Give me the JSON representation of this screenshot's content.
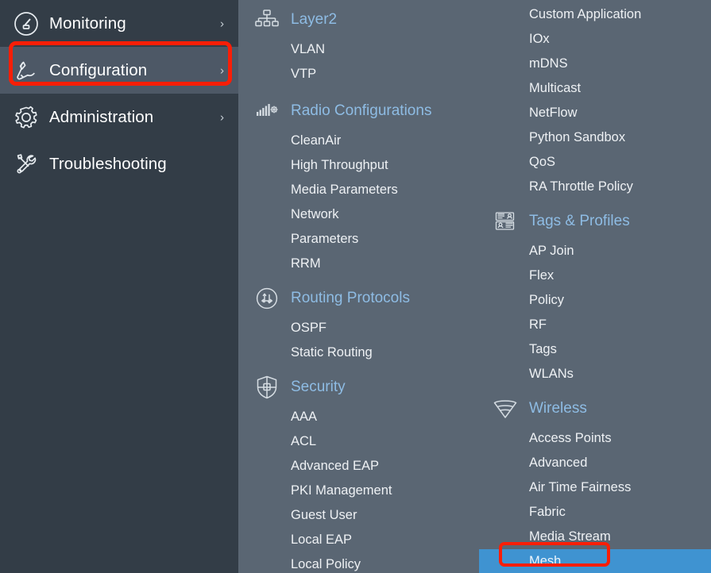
{
  "theme": {
    "sidebar_bg": "#333d47",
    "sidebar_selected_bg": "#4d5866",
    "flyout_bg": "#5a6673",
    "group_header_color": "#8ebce4",
    "leaf_color": "#eef1f4",
    "active_leaf_bg": "#3f93d1",
    "annotation_color": "#fa1e07"
  },
  "sidebar": {
    "items": [
      {
        "label": "Monitoring",
        "icon": "gauge-icon",
        "chevron": "›",
        "selected": false,
        "annotated": false
      },
      {
        "label": "Configuration",
        "icon": "wrench-icon",
        "chevron": "›",
        "selected": true,
        "annotated": true
      },
      {
        "label": "Administration",
        "icon": "gear-icon",
        "chevron": "›",
        "selected": false,
        "annotated": false
      },
      {
        "label": "Troubleshooting",
        "icon": "tools-icon",
        "chevron": "",
        "selected": false,
        "annotated": false
      }
    ]
  },
  "flyout": {
    "column_1": [
      {
        "group": "Layer2",
        "icon": "hierarchy-icon",
        "items": [
          "VLAN",
          "VTP"
        ]
      },
      {
        "group": "Radio Configurations",
        "icon": "signal-gear-icon",
        "items": [
          "CleanAir",
          "High Throughput",
          "Media Parameters",
          "Network",
          "Parameters",
          "RRM"
        ]
      },
      {
        "group": "Routing Protocols",
        "icon": "router-icon",
        "items": [
          "OSPF",
          "Static Routing"
        ]
      },
      {
        "group": "Security",
        "icon": "shield-icon",
        "items": [
          "AAA",
          "ACL",
          "Advanced EAP",
          "PKI Management",
          "Guest User",
          "Local EAP",
          "Local Policy"
        ]
      }
    ],
    "column_2": [
      {
        "group": "",
        "icon": "",
        "items": [
          "Custom Application",
          "IOx",
          "mDNS",
          "Multicast",
          "NetFlow",
          "Python Sandbox",
          "QoS",
          "RA Throttle Policy"
        ]
      },
      {
        "group": "Tags & Profiles",
        "icon": "tags-profiles-icon",
        "items": [
          "AP Join",
          "Flex",
          "Policy",
          "RF",
          "Tags",
          "WLANs"
        ]
      },
      {
        "group": "Wireless",
        "icon": "wifi-cone-icon",
        "items": [
          "Access Points",
          "Advanced",
          "Air Time Fairness",
          "Fabric",
          "Media Stream",
          "Mesh"
        ]
      }
    ],
    "active_item": "Mesh"
  },
  "annotations": [
    {
      "target": "Configuration",
      "shape": "rounded-rectangle",
      "color": "#fa1e07"
    },
    {
      "target": "Mesh",
      "shape": "rounded-rectangle",
      "color": "#fa1e07"
    }
  ]
}
